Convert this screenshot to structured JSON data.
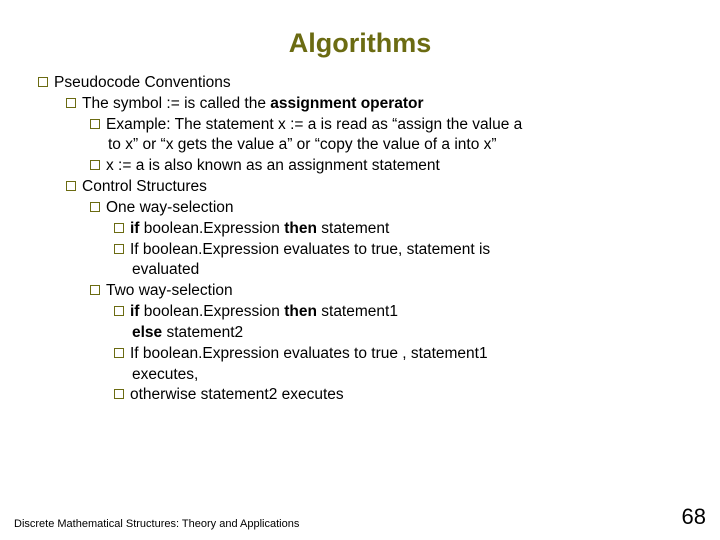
{
  "title": "Algorithms",
  "lines": {
    "l0": "Pseudocode Conventions",
    "l1_pre": "The symbol := is called the ",
    "l1_bold": "assignment operator",
    "l2": "Example: The statement x := a is read as “assign the value a",
    "l2c": "to x” or “x gets the value a” or “copy the value of a into x”",
    "l3": "x := a is also known as an assignment statement",
    "l4": "Control Structures",
    "l5": "One way-selection",
    "l6_b1": "if",
    "l6_mid": " boolean.Expression ",
    "l6_b2": "then",
    "l6_tail": " statement",
    "l7": "If boolean.Expression evaluates to true, statement is",
    "l7c": "evaluated",
    "l8": "Two way-selection",
    "l9_b1": "if",
    "l9_mid": " boolean.Expression ",
    "l9_b2": "then",
    "l9_tail": " statement1",
    "l9c_b": "else",
    "l9c_tail": " statement2",
    "l10": "If boolean.Expression evaluates to true ,  statement1",
    "l10c": "executes,",
    "l11": "otherwise statement2 executes"
  },
  "footer": {
    "left": "Discrete Mathematical Structures: Theory and Applications",
    "page": "68"
  }
}
